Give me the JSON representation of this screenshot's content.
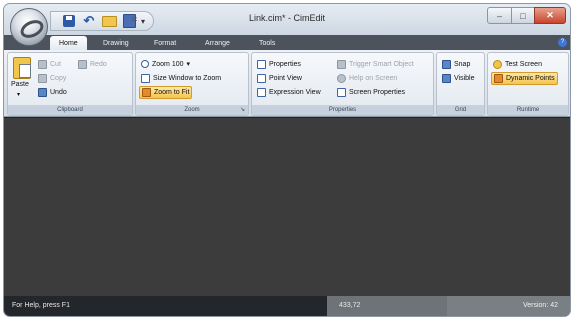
{
  "window": {
    "title": "Link.cim* - CimEdit",
    "controls": {
      "minimize": "–",
      "maximize": "□",
      "close": "✕"
    }
  },
  "quick_access": {
    "icons": [
      "save-icon",
      "undo-icon",
      "open-folder-icon",
      "save-as-icon",
      "customize-dropdown-icon"
    ],
    "separator": "="
  },
  "tabs": [
    {
      "label": "Home",
      "active": true
    },
    {
      "label": "Drawing",
      "active": false
    },
    {
      "label": "Format",
      "active": false
    },
    {
      "label": "Arrange",
      "active": false
    },
    {
      "label": "Tools",
      "active": false
    }
  ],
  "help_icon": "?",
  "ribbon": {
    "clipboard": {
      "label": "Clipboard",
      "paste": "Paste",
      "paste_arrow": "▾",
      "cut": "Cut",
      "redo": "Redo",
      "copy": "Copy",
      "undo": "Undo"
    },
    "zoom": {
      "label": "Zoom",
      "zoom100": "Zoom 100",
      "size_window": "Size Window to Zoom",
      "zoom_fit": "Zoom to Fit",
      "launcher": "↘"
    },
    "properties": {
      "label": "Properties",
      "properties": "Properties",
      "point_view": "Point View",
      "expression_view": "Expression View",
      "trigger_smart": "Trigger Smart Object",
      "help_on_screen": "Help on Screen",
      "screen_properties": "Screen Properties"
    },
    "grid": {
      "label": "Grid",
      "snap": "Snap",
      "visible": "Visible"
    },
    "runtime": {
      "label": "Runtime",
      "test_screen": "Test Screen",
      "dynamic_points": "Dynamic Points"
    }
  },
  "status": {
    "help_text": "For Help, press F1",
    "coordinates": "433,72",
    "version": "Version: 42"
  }
}
